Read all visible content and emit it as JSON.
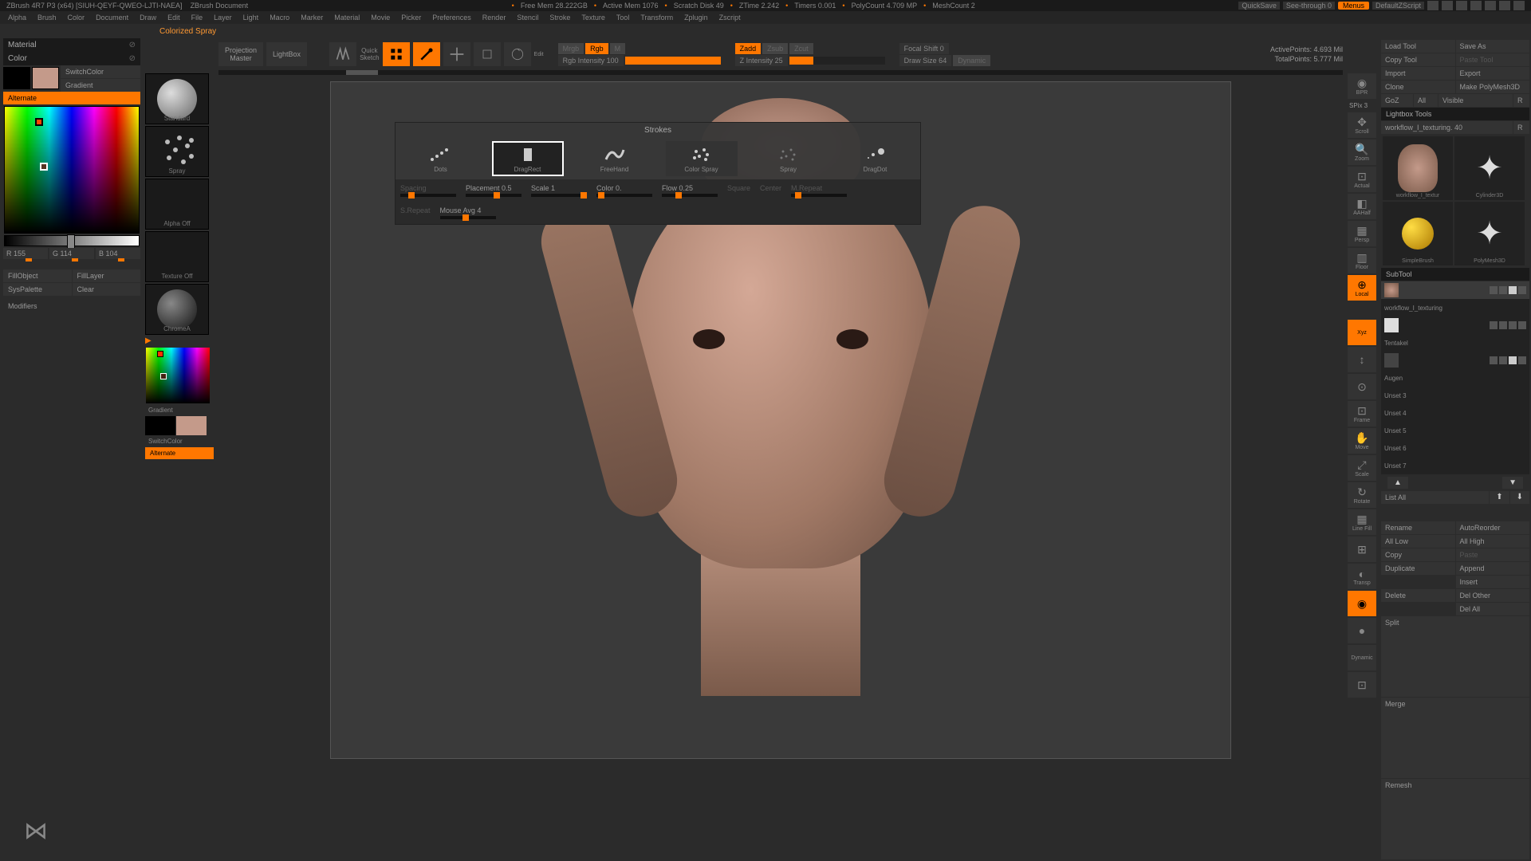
{
  "titlebar": {
    "app": "ZBrush 4R7 P3 (x64) [SIUH-QEYF-QWEO-LJTI-NAEA]",
    "doc": "ZBrush Document",
    "freemem": "Free Mem 28.222GB",
    "activemem": "Active Mem 1076",
    "scratch": "Scratch Disk 49",
    "ztime": "ZTime 2.242",
    "timers": "Timers 0.001",
    "polycount": "PolyCount 4.709 MP",
    "meshcount": "MeshCount 2",
    "quicksave": "QuickSave",
    "seethrough": "See-through  0",
    "menus": "Menus",
    "script": "DefaultZScript"
  },
  "menu": [
    "Alpha",
    "Brush",
    "Color",
    "Document",
    "Draw",
    "Edit",
    "File",
    "Layer",
    "Light",
    "Macro",
    "Marker",
    "Material",
    "Movie",
    "Picker",
    "Preferences",
    "Render",
    "Stencil",
    "Stroke",
    "Texture",
    "Tool",
    "Transform",
    "Zplugin",
    "Zscript"
  ],
  "toolname": "Colorized Spray",
  "left": {
    "material": "Material",
    "color": "Color",
    "switchcolor": "SwitchColor",
    "gradient": "Gradient",
    "alternate": "Alternate",
    "r": "R 155",
    "g": "G 114",
    "b": "B 104",
    "fillobject": "FillObject",
    "filllayer": "FillLayer",
    "syspalette": "SysPalette",
    "clear": "Clear",
    "modifiers": "Modifiers"
  },
  "col2": {
    "standard": "Standard",
    "spray": "Spray",
    "alphaoff": "Alpha Off",
    "textureoff": "Texture Off",
    "chrome": "ChromeA",
    "gradient": "Gradient",
    "switchcolor": "SwitchColor",
    "alternate": "Alternate"
  },
  "top": {
    "projmaster": "Projection\nMaster",
    "lightbox": "LightBox",
    "quicksketch": "Quick\nSketch",
    "edit": "Edit",
    "draw": "Draw",
    "move": "Move",
    "scale": "Scale",
    "rotate": "Rotate",
    "mrgb": "Mrgb",
    "rgb": "Rgb",
    "m": "M",
    "rgbint": "Rgb Intensity 100",
    "zadd": "Zadd",
    "zsub": "Zsub",
    "zcut": "Zcut",
    "zint": "Z Intensity 25",
    "focal": "Focal Shift 0",
    "drawsize": "Draw Size 64",
    "dynamic": "Dynamic",
    "activepts": "ActivePoints: 4.693 Mil",
    "totalpts": "TotalPoints: 5.777 Mil"
  },
  "strokes": {
    "title": "Strokes",
    "items": [
      "Dots",
      "DragRect",
      "FreeHand",
      "Color Spray",
      "Spray",
      "DragDot"
    ],
    "spacing": "Spacing",
    "placement": "Placement 0.5",
    "scale": "Scale 1",
    "colorv": "Color 0.",
    "flow": "Flow 0.25",
    "square": "Square",
    "center": "Center",
    "mrepeat": "M.Repeat",
    "srepeat": "S.Repeat",
    "mouseavg": "Mouse Avg 4"
  },
  "righticons": [
    "BPR",
    "SPix 3",
    "Scroll",
    "Zoom",
    "Actual",
    "AAHalf",
    "Persp",
    "Floor",
    "Local",
    "Xyz",
    "",
    "",
    "Frame",
    "Move",
    "Scale",
    "Rotate",
    "Line Fill",
    "",
    "Transp",
    "",
    "",
    "Dynamic",
    ""
  ],
  "right": {
    "loadtool": "Load Tool",
    "saveas": "Save As",
    "copytool": "Copy Tool",
    "pastetool": "Paste Tool",
    "import": "Import",
    "export": "Export",
    "clone": "Clone",
    "makepoly": "Make PolyMesh3D",
    "goz": "GoZ",
    "all": "All",
    "visible": "Visible",
    "r": "R",
    "lightbox": "Lightbox Tools",
    "toolname": "workflow_I_texturing. 40",
    "thumbs": [
      "workflow_I_textur",
      "Cylinder3D",
      "SimpleBrush",
      "PolyMesh3D"
    ],
    "subtool": "SubTool",
    "subtools": [
      "workflow_I_texturing",
      "",
      "Tentakel",
      "",
      "Augen",
      "Unset 3",
      "Unset 4",
      "Unset 5",
      "Unset 6",
      "Unset 7"
    ],
    "listall": "List All",
    "rename": "Rename",
    "autoreorder": "AutoReorder",
    "alllow": "All Low",
    "allhigh": "All High",
    "copy": "Copy",
    "paste": "Paste",
    "duplicate": "Duplicate",
    "append": "Append",
    "insert": "Insert",
    "delete": "Delete",
    "delother": "Del Other",
    "delall": "Del All",
    "split": "Split",
    "merge": "Merge",
    "remesh": "Remesh"
  },
  "chart_data": null
}
